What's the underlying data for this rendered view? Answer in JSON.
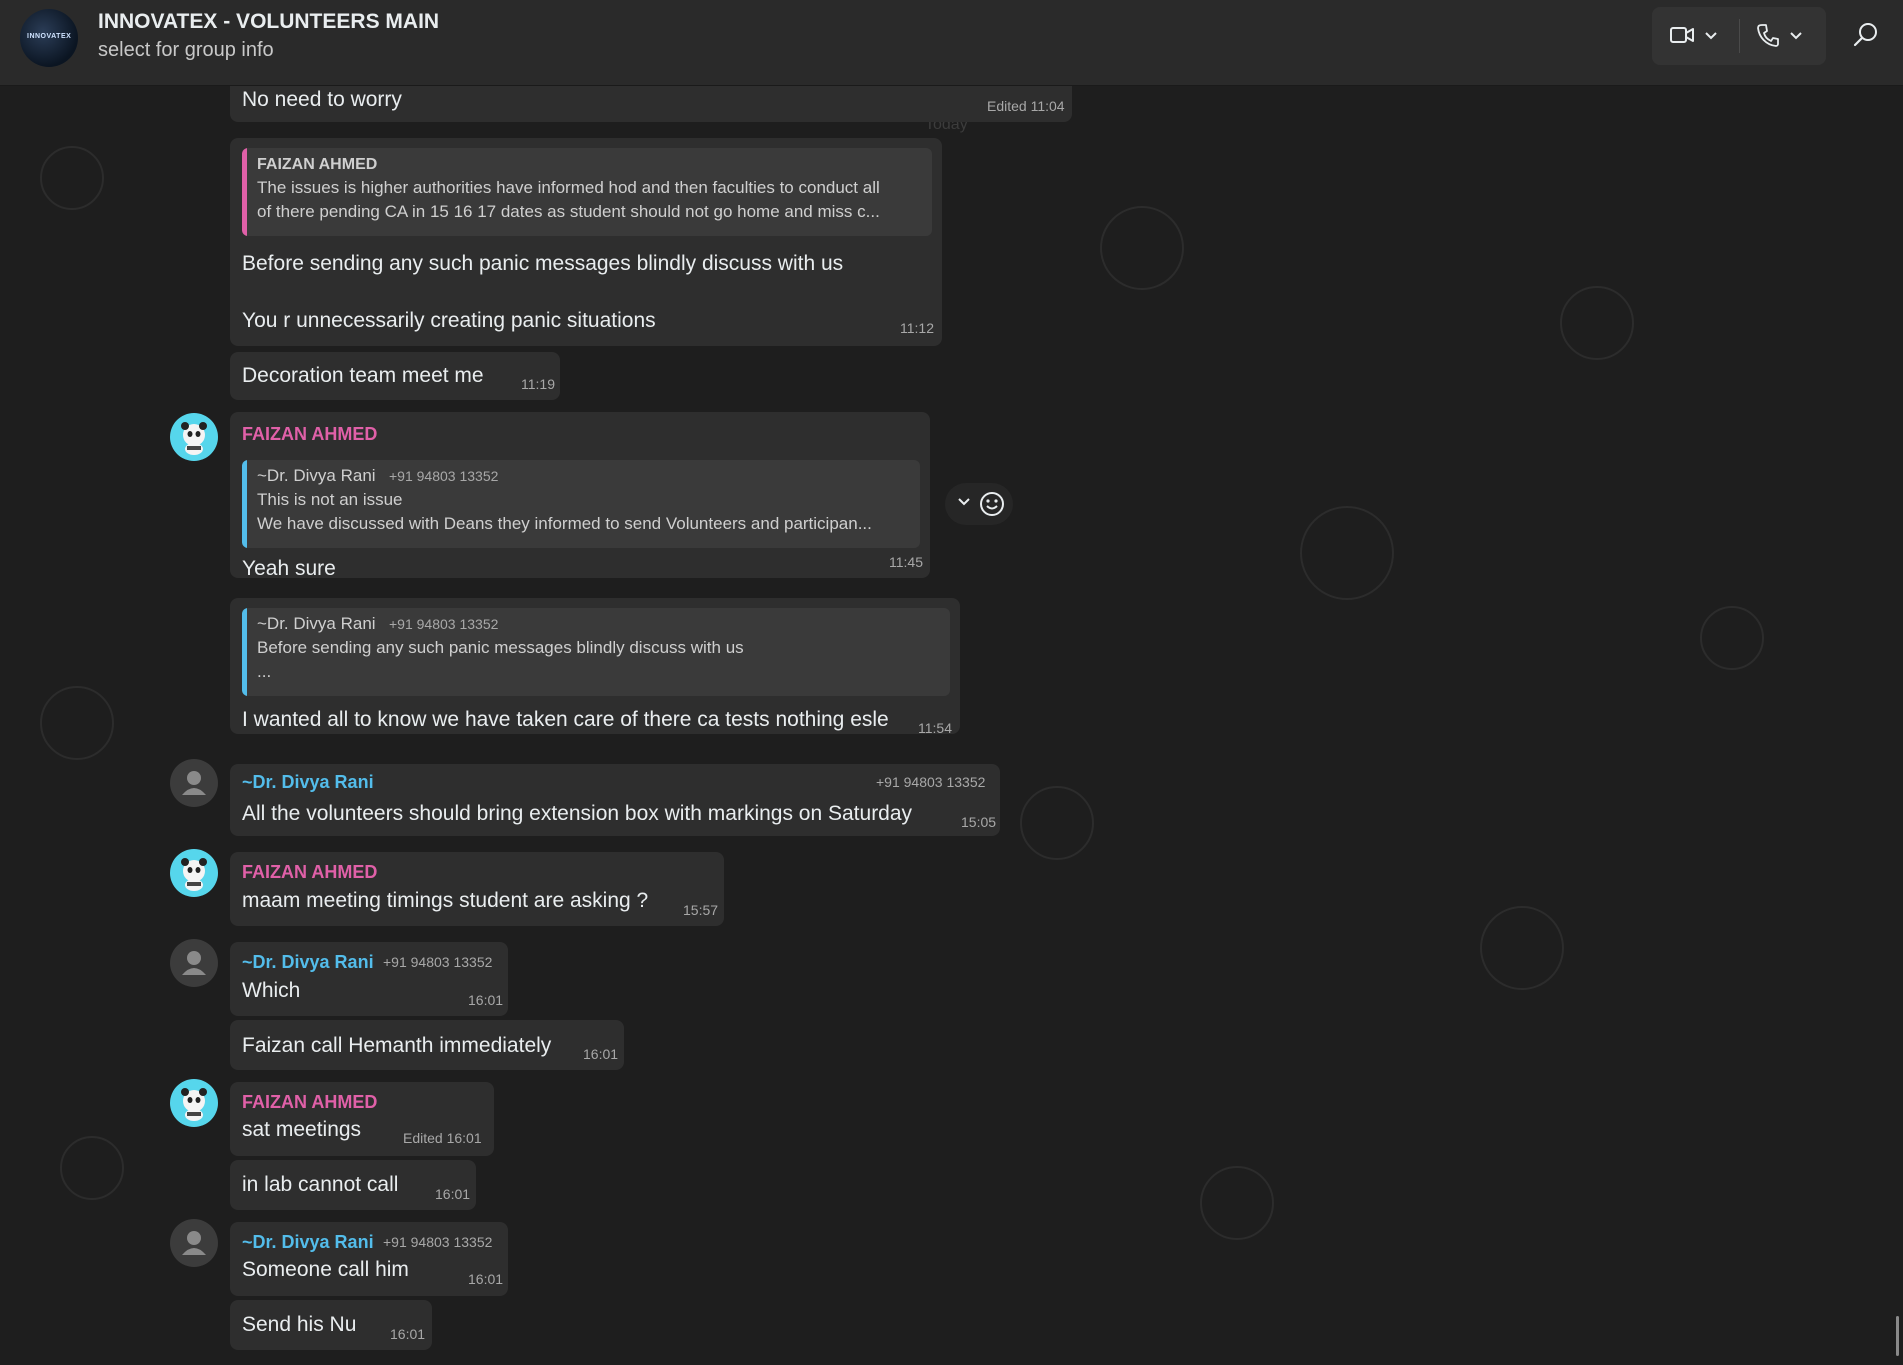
{
  "header": {
    "group_name": "INNOVATEX - VOLUNTEERS MAIN",
    "subtitle": "select for group info",
    "avatar_text": "INNOVATEX",
    "video_icon": "video-camera-icon",
    "call_icon": "phone-icon",
    "search_icon": "search-icon"
  },
  "chat": {
    "date_label": "Today",
    "messages": [
      {
        "text": "No need to worry",
        "time": "Edited 11:04"
      },
      {
        "quote_sender": "FAIZAN AHMED",
        "quote_line1": "The issues is higher authorities have informed hod and then faculties to conduct all",
        "quote_line2": "of there pending CA in 15 16 17 dates as student should not go home and miss c...",
        "line1": "Before sending any such panic messages blindly discuss with us",
        "line2": "You r unnecessarily creating panic situations",
        "time": "11:12"
      },
      {
        "text": "Decoration team meet me",
        "time": "11:19"
      },
      {
        "sender": "FAIZAN AHMED",
        "quote_sender": "~Dr. Divya Rani",
        "quote_phone": "+91 94803 13352",
        "quote_line1": "This is not an issue",
        "quote_line2": "We have discussed with Deans they informed to send Volunteers and participan...",
        "text": "Yeah sure",
        "time": "11:45"
      },
      {
        "quote_sender": "~Dr. Divya Rani",
        "quote_phone": "+91 94803 13352",
        "quote_line1": "Before sending any such panic messages blindly discuss with us",
        "quote_line2": "...",
        "text": "I wanted all to know we have taken care of there ca tests nothing esle",
        "time": "11:54"
      },
      {
        "sender": "~Dr. Divya Rani",
        "phone": "+91 94803 13352",
        "text": "All the volunteers should bring extension box  with markings on  Saturday",
        "time": "15:05"
      },
      {
        "sender": "FAIZAN AHMED",
        "text": "maam meeting timings student are asking ?",
        "time": "15:57"
      },
      {
        "sender": "~Dr. Divya Rani",
        "phone": "+91 94803 13352",
        "text": "Which",
        "time": "16:01"
      },
      {
        "text": "Faizan call Hemanth immediately",
        "time": "16:01"
      },
      {
        "sender": "FAIZAN AHMED",
        "text": "sat meetings",
        "time": "Edited 16:01"
      },
      {
        "text": "in lab cannot call",
        "time": "16:01"
      },
      {
        "sender": "~Dr. Divya Rani",
        "phone": "+91 94803 13352",
        "text": "Someone call him",
        "time": "16:01"
      },
      {
        "text": "Send his Nu",
        "time": "16:01"
      }
    ]
  },
  "colors": {
    "background": "#1e1e1e",
    "bubble": "#2e2e2e",
    "faizan_name": "#e060a8",
    "divya_name": "#53bdeb",
    "header": "#2a2a2a"
  },
  "icons": {
    "hover_menu": "chevron-down-icon",
    "react": "smiley-icon"
  }
}
